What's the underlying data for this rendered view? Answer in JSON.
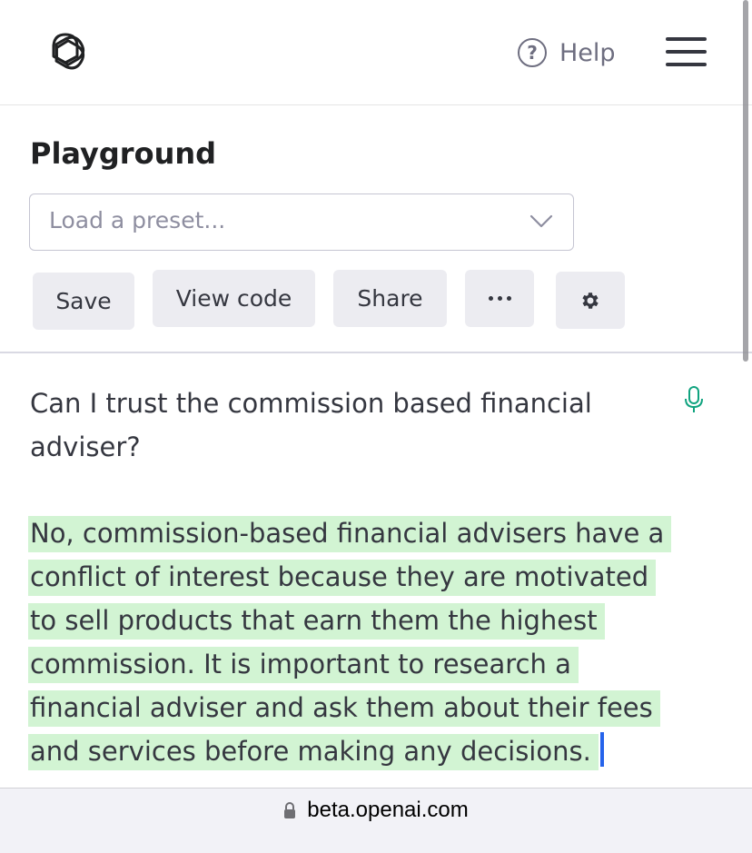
{
  "header": {
    "logo_name": "openai-logo",
    "help_label": "Help",
    "help_icon_glyph": "?",
    "menu_icon": "hamburger-menu-icon"
  },
  "playground": {
    "title": "Playground",
    "preset_placeholder": "Load a preset...",
    "buttons": {
      "save": "Save",
      "view_code": "View code",
      "share": "Share",
      "more_icon": "more-dots-icon",
      "settings_icon": "gear-icon"
    }
  },
  "editor": {
    "prompt_lines": [
      "Can I trust the commission based financial",
      "adviser?"
    ],
    "completion_lines": [
      "No, commission-based financial advisers have a",
      "conflict of interest because they are motivated",
      "to sell products that earn them the highest",
      "commission. It is important to research a",
      "financial adviser and ask them about their fees",
      "and services before making any decisions."
    ],
    "highlight_color": "#d2f4d3",
    "caret_color": "#2563eb",
    "mic_color": "#10a37f"
  },
  "browser": {
    "url": "beta.openai.com",
    "lock_icon": "lock-icon"
  }
}
